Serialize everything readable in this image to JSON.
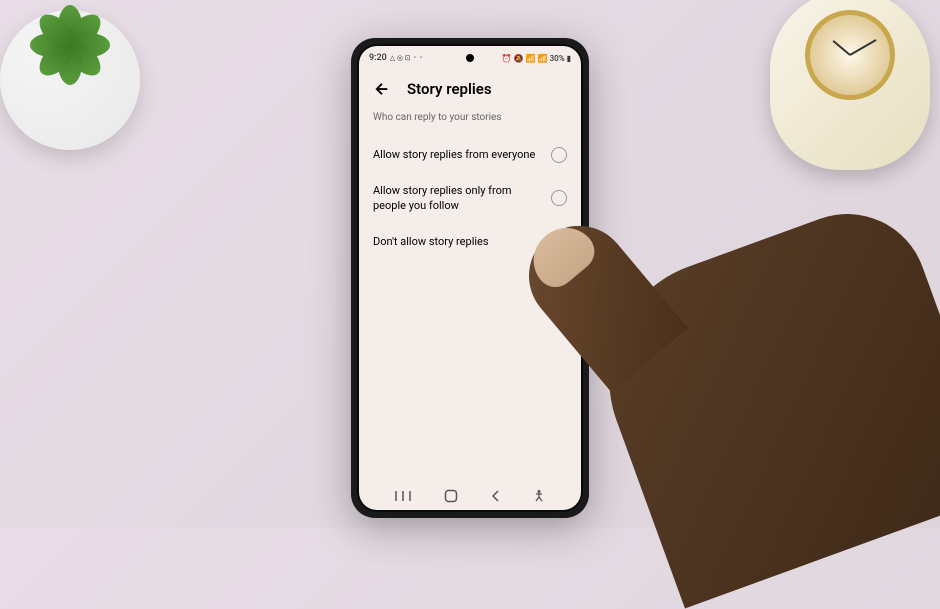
{
  "status_bar": {
    "time": "9:20",
    "icons_left": "△ ◎ ⊡",
    "dots": "• •",
    "icons_right": "⏰ 🔕 📶 ⚡ 📶 30% 🔋",
    "battery_text": "30%"
  },
  "header": {
    "title": "Story replies"
  },
  "content": {
    "subtitle": "Who can reply to your stories",
    "options": [
      {
        "label": "Allow story replies from everyone",
        "selected": false
      },
      {
        "label": "Allow story replies only from people you follow",
        "selected": false
      },
      {
        "label": "Don't allow story replies",
        "selected": true
      }
    ]
  }
}
